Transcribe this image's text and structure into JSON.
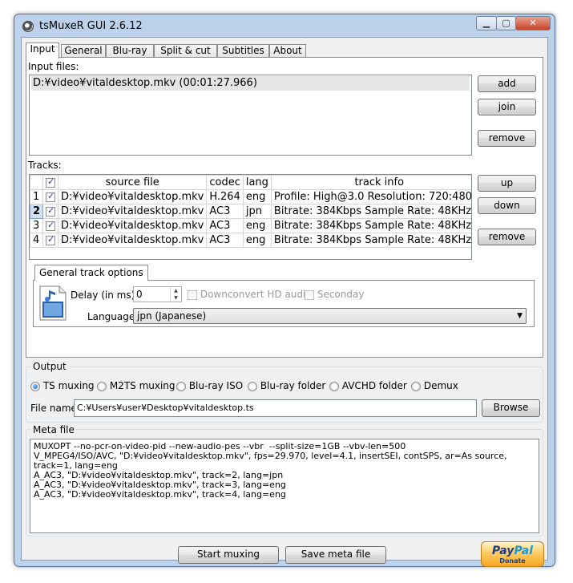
{
  "window": {
    "title": "tsMuxeR GUI 2.6.12"
  },
  "tabs": [
    "Input",
    "General",
    "Blu-ray",
    "Split & cut",
    "Subtitles",
    "About"
  ],
  "input": {
    "files_label": "Input files:",
    "files": [
      "D:¥video¥vitaldesktop.mkv (00:01:27.966)"
    ],
    "add_label": "add",
    "join_label": "join",
    "remove_label": "remove"
  },
  "tracks": {
    "label": "Tracks:",
    "headers": [
      "source file",
      "codec",
      "lang",
      "track info"
    ],
    "rows": [
      {
        "num": "1",
        "checked": true,
        "source": "D:¥video¥vitaldesktop.mkv",
        "codec": "H.264",
        "lang": "eng",
        "info": "Profile: High@3.0  Resolution: 720:480···"
      },
      {
        "num": "2",
        "checked": true,
        "source": "D:¥video¥vitaldesktop.mkv",
        "codec": "AC3",
        "lang": "jpn",
        "info": "Bitrate: 384Kbps Sample Rate: 48KHz ···"
      },
      {
        "num": "3",
        "checked": true,
        "source": "D:¥video¥vitaldesktop.mkv",
        "codec": "AC3",
        "lang": "eng",
        "info": "Bitrate: 384Kbps Sample Rate: 48KHz ···"
      },
      {
        "num": "4",
        "checked": true,
        "source": "D:¥video¥vitaldesktop.mkv",
        "codec": "AC3",
        "lang": "eng",
        "info": "Bitrate: 384Kbps Sample Rate: 48KHz ···"
      }
    ],
    "up_label": "up",
    "down_label": "down",
    "remove_label": "remove"
  },
  "track_options": {
    "tab_label": "General track options",
    "delay_label": "Delay (in ms):",
    "delay_value": "0",
    "downconvert_label": "Downconvert HD audio",
    "secondary_label": "Seconday",
    "language_label": "Language:",
    "language_value": "jpn (Japanese)"
  },
  "output": {
    "label": "Output",
    "options": [
      "TS muxing",
      "M2TS muxing",
      "Blu-ray ISO",
      "Blu-ray folder",
      "AVCHD folder",
      "Demux"
    ],
    "selected": "TS muxing",
    "filename_label": "File name",
    "filename_value": "C:¥Users¥user¥Desktop¥vitaldesktop.ts",
    "browse_label": "Browse"
  },
  "meta": {
    "label": "Meta file",
    "text": "MUXOPT --no-pcr-on-video-pid --new-audio-pes --vbr  --split-size=1GB --vbv-len=500\nV_MPEG4/ISO/AVC, \"D:¥video¥vitaldesktop.mkv\", fps=29.970, level=4.1, insertSEI, contSPS, ar=As source, track=1, lang=eng\nA_AC3, \"D:¥video¥vitaldesktop.mkv\", track=2, lang=jpn\nA_AC3, \"D:¥video¥vitaldesktop.mkv\", track=3, lang=eng\nA_AC3, \"D:¥video¥vitaldesktop.mkv\", track=4, lang=eng"
  },
  "actions": {
    "start_label": "Start muxing",
    "save_label": "Save meta file"
  },
  "paypal": {
    "brand_a": "Pay",
    "brand_b": "Pal",
    "donate": "Donate"
  },
  "colors": {
    "window_frame": "#bcd2ea",
    "selection": "#e5e5e5",
    "paypal": "#fecb62"
  }
}
